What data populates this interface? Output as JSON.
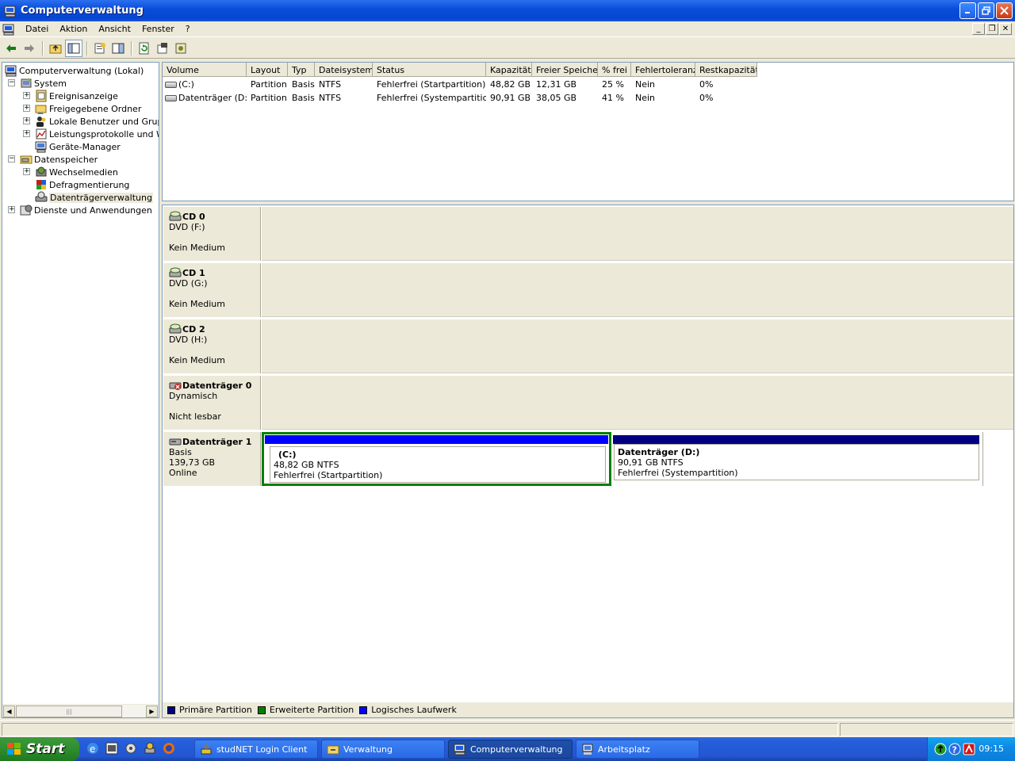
{
  "window": {
    "title": "Computerverwaltung"
  },
  "menu": {
    "items": [
      "Datei",
      "Aktion",
      "Ansicht",
      "Fenster",
      "?"
    ]
  },
  "tree": {
    "root": "Computerverwaltung (Lokal)",
    "system": "System",
    "system_items": [
      "Ereignisanzeige",
      "Freigegebene Ordner",
      "Lokale Benutzer und Gruppe",
      "Leistungsprotokolle und War",
      "Geräte-Manager"
    ],
    "storage": "Datenspeicher",
    "storage_items": [
      "Wechselmedien",
      "Defragmentierung",
      "Datenträgerverwaltung"
    ],
    "services": "Dienste und Anwendungen"
  },
  "volumes": {
    "headers": [
      "Volume",
      "Layout",
      "Typ",
      "Dateisystem",
      "Status",
      "Kapazität",
      "Freier Speicher",
      "% frei",
      "Fehlertoleranz",
      "Restkapazität"
    ],
    "rows": [
      [
        "(C:)",
        "Partition",
        "Basis",
        "NTFS",
        "Fehlerfrei (Startpartition)",
        "48,82 GB",
        "12,31 GB",
        "25 %",
        "Nein",
        "0%"
      ],
      [
        "Datenträger (D:)",
        "Partition",
        "Basis",
        "NTFS",
        "Fehlerfrei (Systempartition)",
        "90,91 GB",
        "38,05 GB",
        "41 %",
        "Nein",
        "0%"
      ]
    ]
  },
  "disks": [
    {
      "name": "CD 0",
      "line1": "DVD (F:)",
      "line2": "",
      "line3": "Kein Medium"
    },
    {
      "name": "CD 1",
      "line1": "DVD (G:)",
      "line2": "",
      "line3": "Kein Medium"
    },
    {
      "name": "CD 2",
      "line1": "DVD (H:)",
      "line2": "",
      "line3": "Kein Medium"
    },
    {
      "name": "Datenträger 0",
      "line1": "Dynamisch",
      "line2": "",
      "line3": "Nicht lesbar"
    },
    {
      "name": "Datenträger 1",
      "line1": "Basis",
      "line2": "139,73 GB",
      "line3": "Online"
    }
  ],
  "partitions": [
    {
      "name": "(C:)",
      "size": "48,82 GB NTFS",
      "status": "Fehlerfrei (Startpartition)",
      "bar_color": "#0000FF"
    },
    {
      "name": "Datenträger  (D:)",
      "size": "90,91 GB NTFS",
      "status": "Fehlerfrei (Systempartition)",
      "bar_color": "#000080"
    }
  ],
  "legend": [
    {
      "label": "Primäre Partition",
      "color": "#000080"
    },
    {
      "label": "Erweiterte Partition",
      "color": "#008000"
    },
    {
      "label": "Logisches Laufwerk",
      "color": "#0000FF"
    }
  ],
  "taskbar": {
    "start": "Start",
    "tasks": [
      "studNET Login Client",
      "Verwaltung",
      "Computerverwaltung",
      "Arbeitsplatz"
    ],
    "clock": "09:15"
  },
  "colors": {
    "selected_partition_border": "#008000",
    "title_bar": "#0A4FD8"
  }
}
